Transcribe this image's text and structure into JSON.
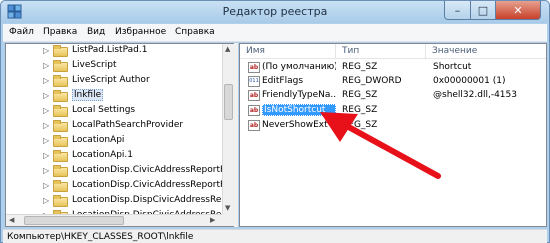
{
  "window": {
    "title": "Редактор реестра"
  },
  "window_buttons": {
    "minimize": "–",
    "maximize": "□",
    "close": "✕"
  },
  "menu": [
    "Файл",
    "Правка",
    "Вид",
    "Избранное",
    "Справка"
  ],
  "tree": {
    "items": [
      {
        "label": "ListPad.ListPad.1",
        "expandable": true
      },
      {
        "label": "LiveScript",
        "expandable": true
      },
      {
        "label": "LiveScript Author",
        "expandable": true
      },
      {
        "label": "lnkfile",
        "expandable": true,
        "selected": true
      },
      {
        "label": "Local Settings",
        "expandable": true
      },
      {
        "label": "LocalPathSearchProvider",
        "expandable": true
      },
      {
        "label": "LocationApi",
        "expandable": true
      },
      {
        "label": "LocationApi.1",
        "expandable": true
      },
      {
        "label": "LocationDisp.CivicAddressReportFacto",
        "expandable": true
      },
      {
        "label": "LocationDisp.CivicAddressReportFacto",
        "expandable": true
      },
      {
        "label": "LocationDisp.DispCivicAddressReport",
        "expandable": true
      },
      {
        "label": "LocationDisp.DispCivicAddressReport",
        "expandable": true
      }
    ]
  },
  "list": {
    "columns": [
      "Имя",
      "Тип",
      "Значение"
    ],
    "rows": [
      {
        "icon": "string-value-icon",
        "name": "(По умолчанию)",
        "type": "REG_SZ",
        "value": "Shortcut"
      },
      {
        "icon": "dword-value-icon",
        "name": "EditFlags",
        "type": "REG_DWORD",
        "value": "0x00000001 (1)"
      },
      {
        "icon": "string-value-icon",
        "name": "FriendlyTypeNa...",
        "type": "REG_SZ",
        "value": "@shell32.dll,-4153"
      },
      {
        "icon": "string-value-icon",
        "name": "IsNotShortcut",
        "type": "REG_SZ",
        "value": "",
        "selected": true
      },
      {
        "icon": "string-value-icon",
        "name": "NeverShowExt",
        "type": "REG_SZ",
        "value": ""
      }
    ]
  },
  "status": {
    "path": "Компьютер\\HKEY_CLASSES_ROOT\\lnkfile"
  },
  "colors": {
    "selection": "#3399ff",
    "annotation_arrow": "#e8111a"
  }
}
